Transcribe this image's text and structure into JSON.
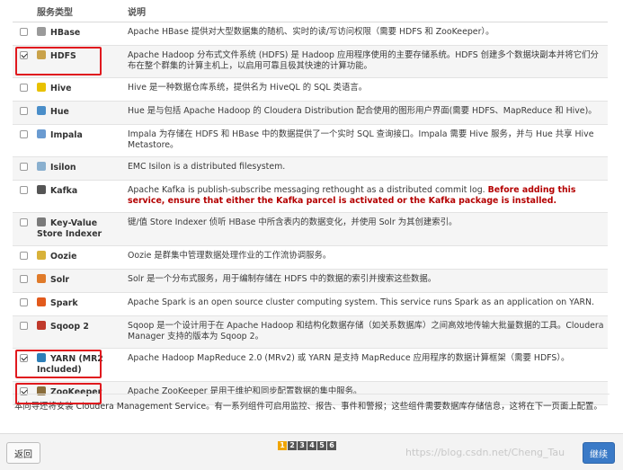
{
  "table": {
    "headers": {
      "type": "服务类型",
      "desc": "说明"
    },
    "rows": [
      {
        "name": "HBase",
        "checked": false,
        "icon": "hbase-icon",
        "desc": "Apache HBase 提供对大型数据集的随机、实时的读/写访问权限（需要 HDFS 和 ZooKeeper）。"
      },
      {
        "name": "HDFS",
        "checked": true,
        "icon": "hdfs-icon",
        "desc": "Apache Hadoop 分布式文件系统 (HDFS) 是 Hadoop 应用程序使用的主要存储系统。HDFS 创建多个数据块副本并将它们分布在整个群集的计算主机上，以启用可靠且极其快速的计算功能。"
      },
      {
        "name": "Hive",
        "checked": false,
        "icon": "hive-icon",
        "desc": "Hive 是一种数据仓库系统，提供名为 HiveQL 的 SQL 类语言。"
      },
      {
        "name": "Hue",
        "checked": false,
        "icon": "hue-icon",
        "desc": "Hue 是与包括 Apache Hadoop 的 Cloudera Distribution 配合使用的图形用户界面(需要 HDFS、MapReduce 和 Hive)。"
      },
      {
        "name": "Impala",
        "checked": false,
        "icon": "impala-icon",
        "desc": "Impala 为存储在 HDFS 和 HBase 中的数据提供了一个实时 SQL 查询接口。Impala 需要 Hive 服务，并与 Hue 共享 Hive Metastore。"
      },
      {
        "name": "Isilon",
        "checked": false,
        "icon": "isilon-icon",
        "desc": "EMC Isilon is a distributed filesystem."
      },
      {
        "name": "Kafka",
        "checked": false,
        "icon": "kafka-icon",
        "desc": "Apache Kafka is publish-subscribe messaging rethought as a distributed commit log. ",
        "warn": "Before adding this service, ensure that either the Kafka parcel is activated or the Kafka package is installed."
      },
      {
        "name": "Key-Value Store Indexer",
        "checked": false,
        "icon": "ks-indexer-icon",
        "desc": "键/值 Store Indexer 侦听 HBase 中所含表内的数据变化，并使用 Solr 为其创建索引。"
      },
      {
        "name": "Oozie",
        "checked": false,
        "icon": "oozie-icon",
        "desc": "Oozie 是群集中管理数据处理作业的工作流协调服务。"
      },
      {
        "name": "Solr",
        "checked": false,
        "icon": "solr-icon",
        "desc": "Solr 是一个分布式服务，用于编制存储在 HDFS 中的数据的索引并搜索这些数据。"
      },
      {
        "name": "Spark",
        "checked": false,
        "icon": "spark-icon",
        "desc": "Apache Spark is an open source cluster computing system. This service runs Spark as an application on YARN."
      },
      {
        "name": "Sqoop 2",
        "checked": false,
        "icon": "sqoop-icon",
        "desc": "Sqoop 是一个设计用于在 Apache Hadoop 和结构化数据存储（如关系数据库）之间高效地传输大批量数据的工具。Cloudera Manager 支持的版本为 Sqoop 2。"
      },
      {
        "name": "YARN (MR2 Included)",
        "checked": true,
        "icon": "yarn-icon",
        "desc": "Apache Hadoop MapReduce 2.0 (MRv2) 或 YARN 是支持 MapReduce 应用程序的数据计算框架（需要 HDFS）。"
      },
      {
        "name": "ZooKeeper",
        "checked": true,
        "icon": "zookeeper-icon",
        "desc": "Apache ZooKeeper 是用于维护和同步配置数据的集中服务。"
      }
    ]
  },
  "footer_note": "本向导还将安装 Cloudera Management Service。有一系列组件可启用监控、报告、事件和警报；这些组件需要数据库存储信息，这将在下一页面上配置。",
  "nav": {
    "back_label": "返回",
    "next_label": "继续",
    "pages": [
      "1",
      "2",
      "3",
      "4",
      "5",
      "6"
    ],
    "current_page": "1"
  },
  "watermark": "https://blog.csdn.net/Cheng_Tau",
  "colors": {
    "highlight": "#e0191e",
    "next_button": "#3a7ac7",
    "warning_text": "#b40000",
    "active_page": "#f0a500"
  }
}
